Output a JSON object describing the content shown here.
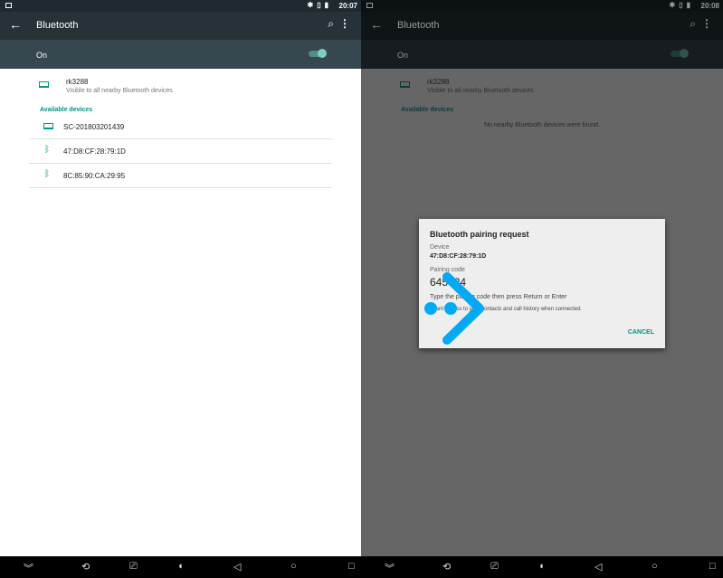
{
  "left": {
    "status": {
      "time": "20:07"
    },
    "toolbar": {
      "title": "Bluetooth"
    },
    "switch_label": "On",
    "self": {
      "name": "rk3288",
      "sub": "Visible to all nearby Bluetooth devices"
    },
    "category": "Available devices",
    "devices": [
      {
        "name": "SC-201803201439",
        "icon": "laptop-icon"
      },
      {
        "name": "47:D8:CF:28:79:1D",
        "icon": "bluetooth-icon"
      },
      {
        "name": "8C:85:90:CA:29:95",
        "icon": "bluetooth-icon"
      }
    ]
  },
  "right": {
    "status": {
      "time": "20:08"
    },
    "toolbar": {
      "title": "Bluetooth"
    },
    "switch_label": "On",
    "self": {
      "name": "rk3288",
      "sub": "Visible to all nearby Bluetooth devices"
    },
    "category": "Available devices",
    "empty": "No nearby Bluetooth devices were found."
  },
  "dialog": {
    "title": "Bluetooth pairing request",
    "device_label": "Device",
    "device": "47:D8:CF:28:79:1D",
    "code_label": "Pairing code",
    "code": "645?24",
    "instruction": "Type the pairing code then press Return or Enter",
    "access": "Grant access to your contacts and call history when connected.",
    "cancel": "CANCEL"
  },
  "colors": {
    "accent": "#009688",
    "toolbar": "#263238",
    "onbar": "#37474f"
  }
}
